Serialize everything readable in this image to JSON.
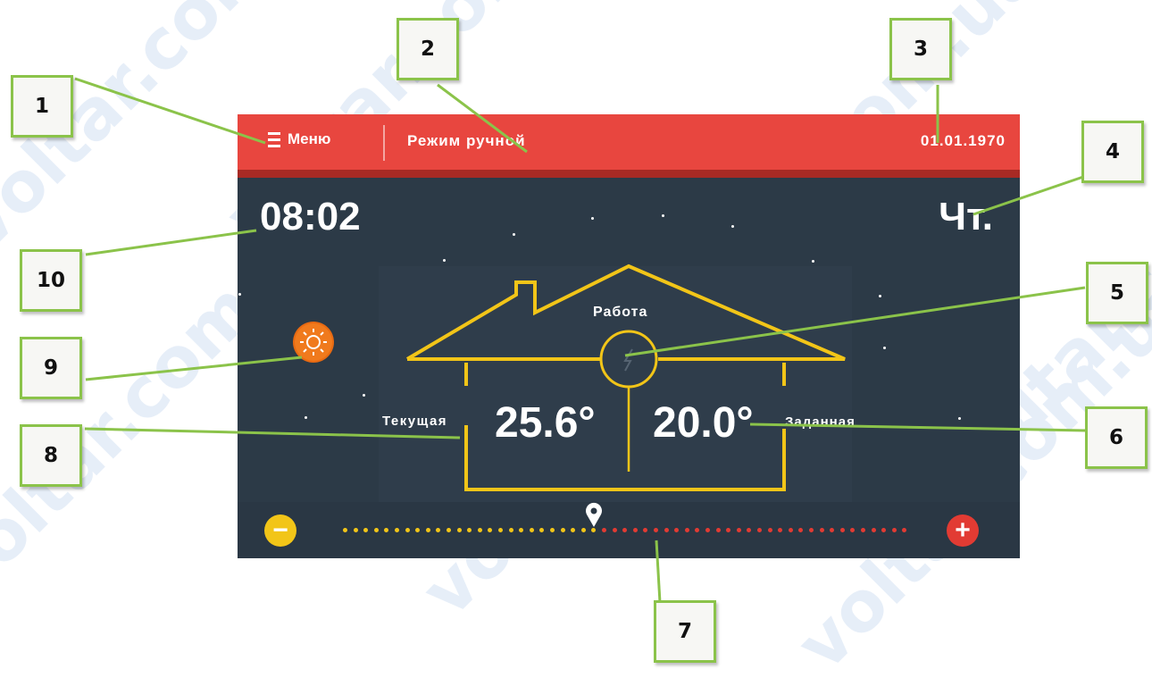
{
  "header": {
    "menu_label": "Меню",
    "mode_label": "Режим ручной",
    "date": "01.01.1970"
  },
  "clock": {
    "time": "08:02",
    "day": "Чт."
  },
  "house": {
    "state_label": "Работа",
    "current_label": "Текущая",
    "current_value": "25.6°",
    "set_label": "Заданная",
    "set_value": "20.0°"
  },
  "slider": {
    "minus_label": "−",
    "plus_label": "+",
    "position_fraction": 0.44
  },
  "callouts": [
    "1",
    "2",
    "3",
    "4",
    "5",
    "6",
    "7",
    "8",
    "9",
    "10"
  ],
  "watermark_text": "voltar.com.ua",
  "colors": {
    "topbar": "#e8463f",
    "screen": "#2c3a47",
    "outline": "#f2c518",
    "minus": "#f2c518",
    "plus": "#e23b33",
    "callout_border": "#8bc34a"
  },
  "icons": {
    "menu": "hamburger-icon",
    "weather": "sun-icon",
    "pump": "lightning-icon",
    "slider_marker": "location-pin-icon"
  }
}
